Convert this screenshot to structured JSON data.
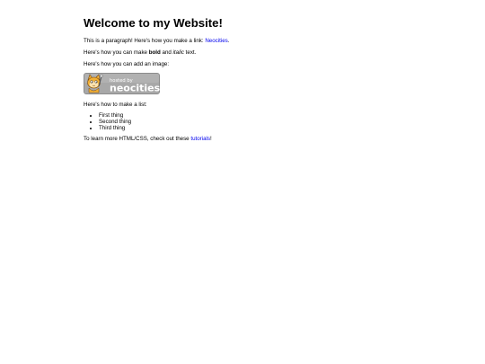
{
  "page": {
    "heading": "Welcome to my Website!",
    "paragraph1": {
      "before": "This is a paragraph! Here's how you make a link: ",
      "link": "Neocities",
      "after": "."
    },
    "paragraph2": {
      "before": "Here's how you can make ",
      "bold": "bold",
      "middle": " and ",
      "italic": "italic",
      "after": " text."
    },
    "paragraph3": "Here's how you can add an image:",
    "badge": {
      "line1": "hosted by",
      "line2": "neocities",
      "colors": {
        "background": "#a8a8a8",
        "border": "#8c8c8c",
        "text": "#ffffff",
        "mascot_fur": "#f2b035",
        "mascot_face": "#fce3b0"
      }
    },
    "paragraph4": "Here's how to make a list:",
    "list": [
      "First thing",
      "Second thing",
      "Third thing"
    ],
    "paragraph5": {
      "before": "To learn more HTML/CSS, check out these ",
      "link": "tutorials",
      "after": "!"
    },
    "link_color": "#0000ee"
  }
}
